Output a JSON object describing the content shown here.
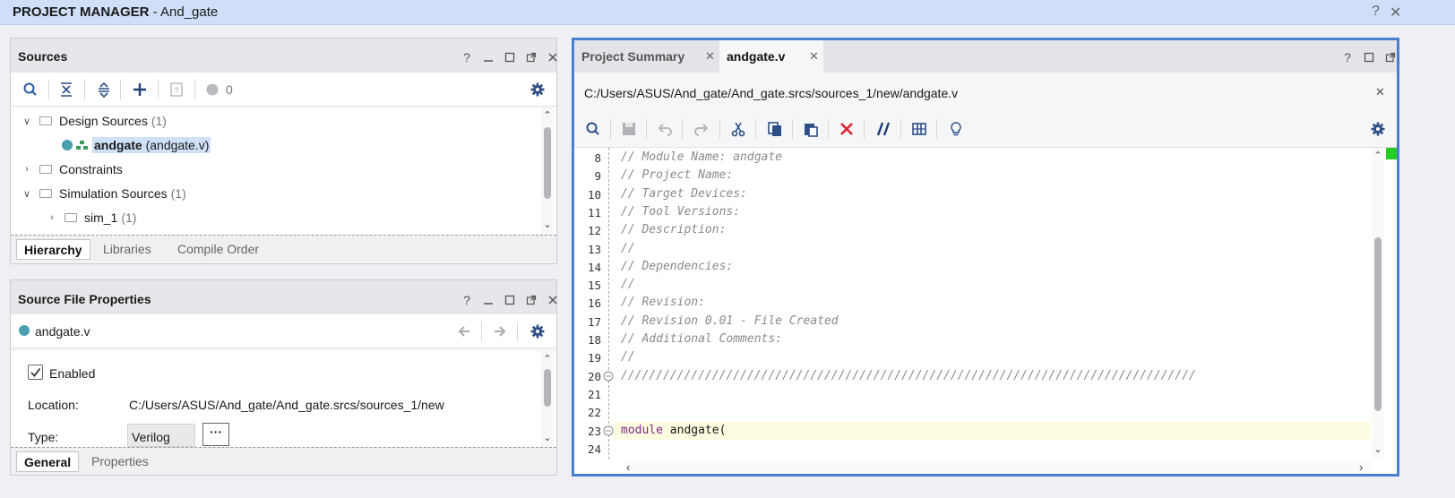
{
  "window": {
    "title_bold": "PROJECT MANAGER",
    "title_rest": " - And_gate",
    "help": "?",
    "close": "✕"
  },
  "sources": {
    "title": "Sources",
    "badge_count": "0",
    "tree": [
      {
        "label": "Design Sources",
        "count": "(1)"
      },
      {
        "label": "andgate",
        "detail": "(andgate.v)"
      },
      {
        "label": "Constraints"
      },
      {
        "label": "Simulation Sources",
        "count": "(1)"
      },
      {
        "label": "sim_1",
        "count": "(1)"
      }
    ],
    "tabs": [
      "Hierarchy",
      "Libraries",
      "Compile Order"
    ]
  },
  "props": {
    "title": "Source File Properties",
    "file": "andgate.v",
    "enabled_label": "Enabled",
    "location_label": "Location:",
    "location_value": "C:/Users/ASUS/And_gate/And_gate.srcs/sources_1/new",
    "type_label": "Type:",
    "type_value": "Verilog",
    "type_more": "···",
    "tabs": [
      "General",
      "Properties"
    ]
  },
  "editor": {
    "tabs": [
      "Project Summary",
      "andgate.v"
    ],
    "path": "C:/Users/ASUS/And_gate/And_gate.srcs/sources_1/new/andgate.v",
    "lines": [
      {
        "n": "8",
        "text": "// Module Name: andgate",
        "type": "comment"
      },
      {
        "n": "9",
        "text": "// Project Name:",
        "type": "comment"
      },
      {
        "n": "10",
        "text": "// Target Devices:",
        "type": "comment"
      },
      {
        "n": "11",
        "text": "// Tool Versions:",
        "type": "comment"
      },
      {
        "n": "12",
        "text": "// Description:",
        "type": "comment"
      },
      {
        "n": "13",
        "text": "//",
        "type": "comment"
      },
      {
        "n": "14",
        "text": "// Dependencies:",
        "type": "comment"
      },
      {
        "n": "15",
        "text": "//",
        "type": "comment"
      },
      {
        "n": "16",
        "text": "// Revision:",
        "type": "comment"
      },
      {
        "n": "17",
        "text": "// Revision 0.01 - File Created",
        "type": "comment"
      },
      {
        "n": "18",
        "text": "// Additional Comments:",
        "type": "comment"
      },
      {
        "n": "19",
        "text": "//",
        "type": "comment"
      },
      {
        "n": "20",
        "text": "//////////////////////////////////////////////////////////////////////////////////",
        "type": "comment"
      },
      {
        "n": "21",
        "text": "",
        "type": "plain"
      },
      {
        "n": "22",
        "text": "",
        "type": "plain"
      },
      {
        "n": "23",
        "kw": "module",
        "text": " andgate(",
        "type": "keyword"
      },
      {
        "n": "24",
        "text": "",
        "type": "plain"
      }
    ]
  },
  "colors": {
    "accent": "#4a7fd0",
    "selection": "#cfe0f7",
    "delete": "#d9232e"
  }
}
